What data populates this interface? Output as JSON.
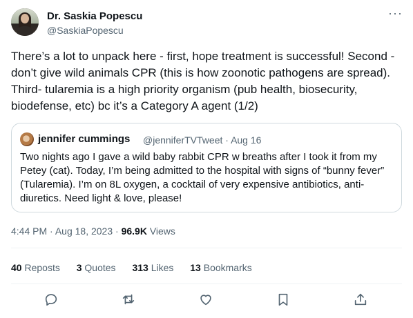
{
  "author": {
    "name": "Dr. Saskia Popescu",
    "handle": "@SaskiaPopescu",
    "avatar_icon": "profile-photo"
  },
  "menu_icon": "more-horizontal-icon",
  "tweet": {
    "text": "There’s a lot to unpack here - first, hope treatment is successful! Second - don’t give wild animals CPR (this is how zoonotic pathogens are spread). Third- tularemia is a high priority organism (pub health, biosecurity, biodefense, etc) bc it’s a Category A agent (1/2)"
  },
  "quoted_tweet": {
    "name": "jennifer cummings",
    "handle": "@jenniferTVTweet",
    "separator": "·",
    "date": "Aug 16",
    "text": "Two nights ago I gave a wild baby rabbit CPR w breaths after I took it from my Petey (cat). Today, I’m being admitted to the hospital with signs of “bunny fever” (Tularemia). I’m on 8L oxygen, a cocktail of very expensive antibiotics, anti-diuretics. Need light & love, please!"
  },
  "meta": {
    "time": "4:44 PM",
    "separator": "·",
    "date": "Aug 18, 2023",
    "views_count": "96.9K",
    "views_label": "Views"
  },
  "stats": {
    "reposts_count": "40",
    "reposts_label": "Reposts",
    "quotes_count": "3",
    "quotes_label": "Quotes",
    "likes_count": "313",
    "likes_label": "Likes",
    "bookmarks_count": "13",
    "bookmarks_label": "Bookmarks"
  },
  "actions": [
    "reply-icon",
    "repost-icon",
    "like-icon",
    "bookmark-icon",
    "share-icon"
  ],
  "colors": {
    "text": "#0f1419",
    "secondary": "#536471",
    "border": "#cfd9de"
  }
}
